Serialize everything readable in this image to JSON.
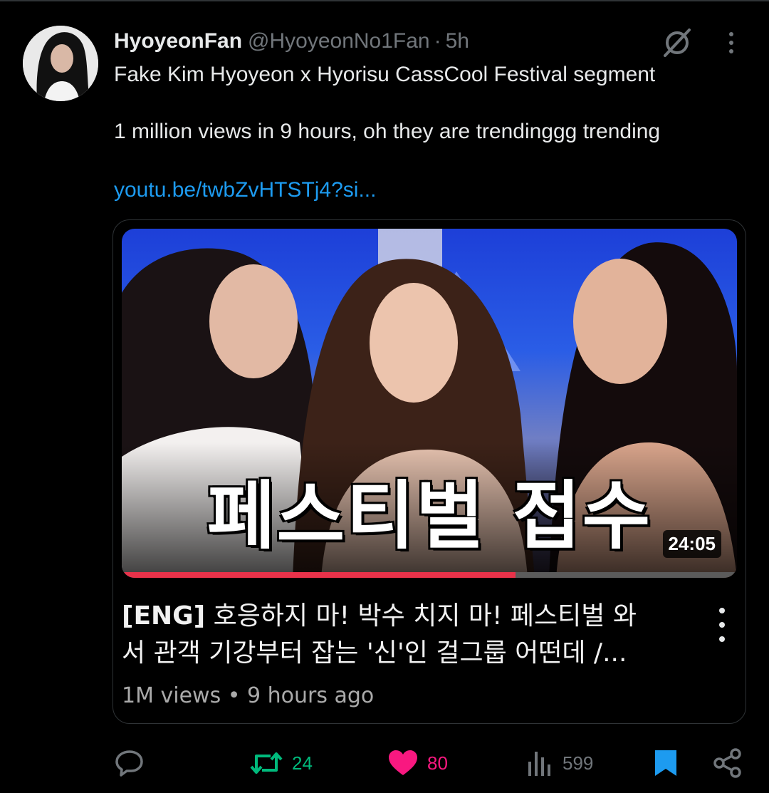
{
  "tweet": {
    "display_name": "HyoyeonFan",
    "handle": "@HyoyeonNo1Fan",
    "separator": "·",
    "time": "5h",
    "line1": "Fake Kim Hyoyeon x Hyorisu CassCool Festival segment",
    "line2": "1 million views in 9 hours, oh they are trendinggg trending",
    "link": "youtu.be/twbZvHTSTj4?si..."
  },
  "video": {
    "thumbnail_title": "페스티벌 접수",
    "duration": "24:05",
    "progress": 0.64,
    "title_tag": "[ENG]",
    "title_line1": " 호응하지 마! 박수 치지 마! 페스티벌 와",
    "title_line2": "서 관객 기강부터 잡는 '신'인 걸그룹 어떤데 /...",
    "meta": "1M views • 9 hours ago"
  },
  "actions": {
    "reply_icon": "reply-icon",
    "retweets": "24",
    "likes": "80",
    "views": "599",
    "bookmark_icon": "bookmark-icon",
    "share_icon": "share-icon"
  },
  "colors": {
    "background": "#000000",
    "link": "#1d9bf0",
    "retweet": "#00ba7c",
    "like": "#f91880",
    "muted": "#71767b",
    "progress": "#e8324a"
  }
}
